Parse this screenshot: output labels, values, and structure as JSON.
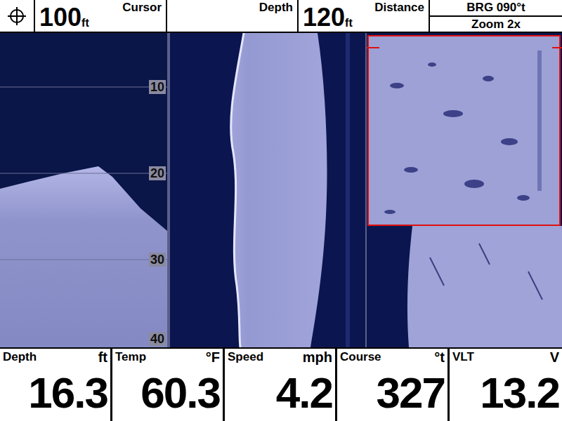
{
  "top_bar": {
    "cursor": {
      "value": "100",
      "unit": "ft",
      "label": "Cursor"
    },
    "depth": {
      "label": "Depth"
    },
    "distance": {
      "value": "120",
      "unit": "ft",
      "label": "Distance"
    },
    "bearing": "BRG 090°t",
    "zoom": "Zoom 2x"
  },
  "depth_scale": [
    "10",
    "20",
    "30",
    "40"
  ],
  "readouts": [
    {
      "label": "Depth",
      "unit": "ft",
      "value": "16.3"
    },
    {
      "label": "Temp",
      "unit": "°F",
      "value": "60.3"
    },
    {
      "label": "Speed",
      "unit": "mph",
      "value": "4.2"
    },
    {
      "label": "Course",
      "unit": "°t",
      "value": "327"
    },
    {
      "label": "VLT",
      "unit": "V",
      "value": "13.2"
    }
  ]
}
